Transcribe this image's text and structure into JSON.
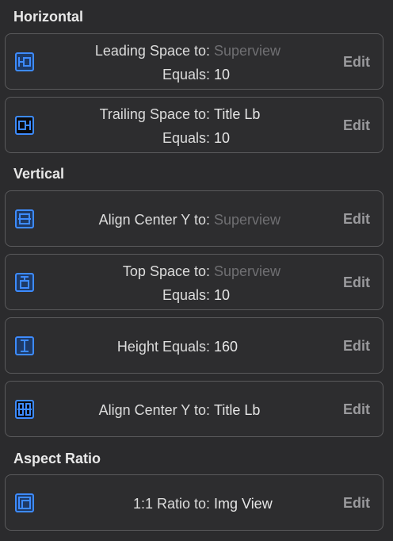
{
  "sections": {
    "horizontal": "Horizontal",
    "vertical": "Vertical",
    "aspect_ratio": "Aspect Ratio"
  },
  "constraints": [
    {
      "icon": "leading-space-icon",
      "label1": "Leading Space to:",
      "value1": "Superview",
      "label2": "Equals:",
      "value2": "10",
      "edit": "Edit"
    },
    {
      "icon": "trailing-space-icon",
      "label1": "Trailing Space to:",
      "value1": "Title Lb",
      "label2": "Equals:",
      "value2": "10",
      "edit": "Edit"
    },
    {
      "icon": "align-center-y-icon",
      "label1": "Align Center Y to:",
      "value1": "Superview",
      "edit": "Edit"
    },
    {
      "icon": "top-space-icon",
      "label1": "Top Space to:",
      "value1": "Superview",
      "label2": "Equals:",
      "value2": "10",
      "edit": "Edit"
    },
    {
      "icon": "height-icon",
      "label1": "Height Equals:",
      "value1": "160",
      "edit": "Edit"
    },
    {
      "icon": "align-center-y-icon",
      "label1": "Align Center Y to:",
      "value1": "Title Lb",
      "edit": "Edit"
    },
    {
      "icon": "aspect-ratio-icon",
      "label1": "1:1 Ratio to:",
      "value1": "Img View",
      "edit": "Edit"
    }
  ],
  "colors": {
    "background": "#2b2b2d",
    "accent_blue": "#3d8bff",
    "dim_text": "#6f6f72",
    "edit_text": "#9a9a9d"
  }
}
